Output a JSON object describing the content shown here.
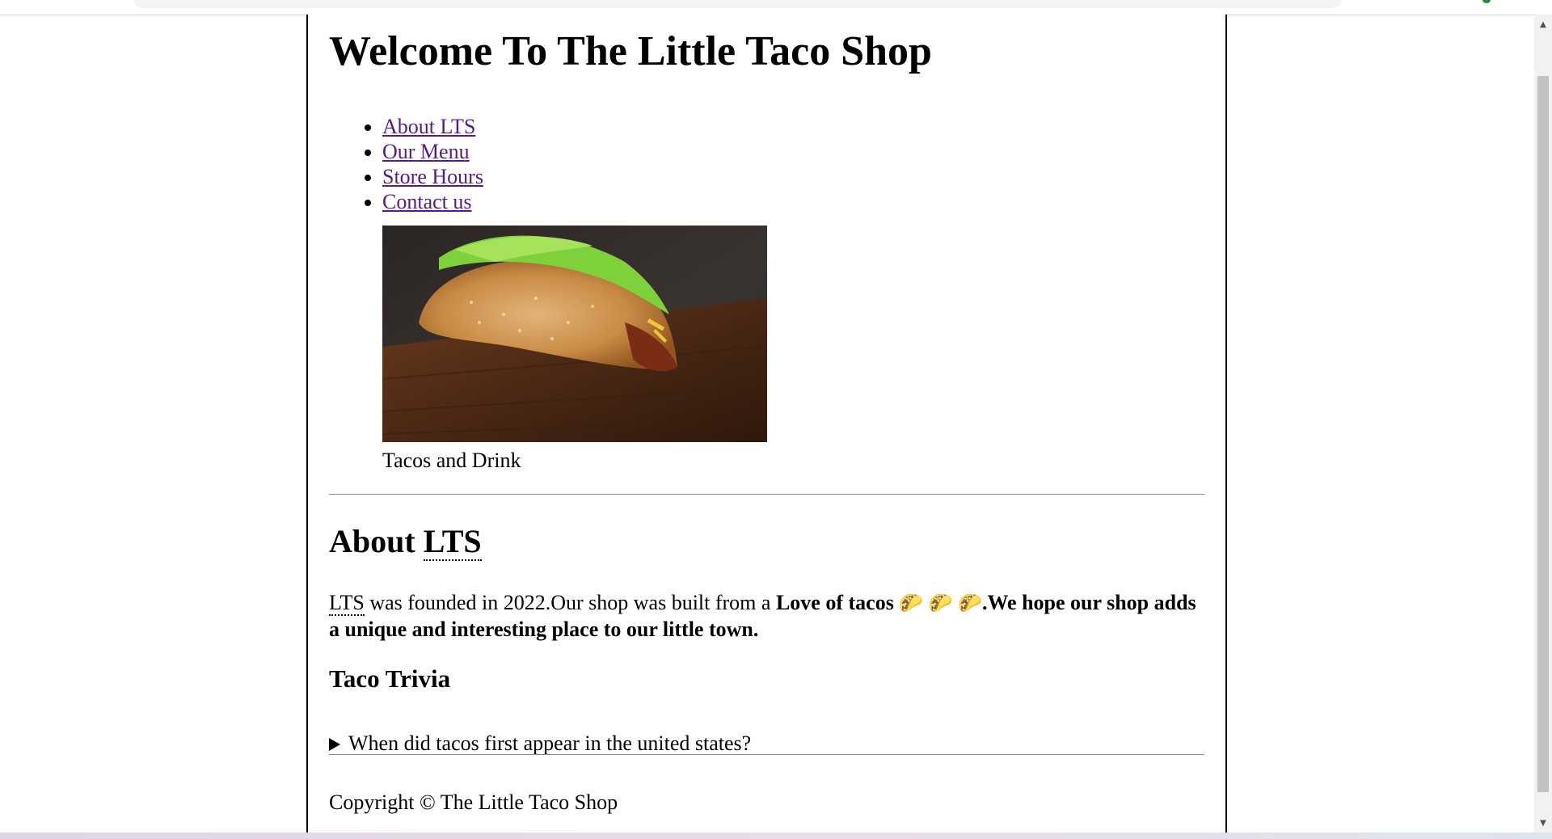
{
  "page": {
    "title": "Welcome To The Little Taco Shop",
    "nav": [
      {
        "label": "About LTS"
      },
      {
        "label": "Our Menu"
      },
      {
        "label": "Store Hours"
      },
      {
        "label": "Contact us"
      }
    ],
    "figure": {
      "caption": "Tacos and Drink",
      "image": "taco-photo"
    },
    "about": {
      "heading_prefix": "About ",
      "heading_abbr": "LTS",
      "text_abbr": "LTS",
      "text_plain": " was founded in 2022.Our shop was built from a ",
      "text_bold_1": "Love of tacos",
      "taco_emoji": "🌮",
      "text_bold_2": ".We hope our shop adds a unique and interesting place to our little town."
    },
    "trivia": {
      "heading": "Taco Trivia",
      "summary": "When did tacos first appear in the united states?"
    },
    "footer": {
      "copyright": "Copyright © The Little Taco Shop"
    }
  },
  "colors": {
    "link": "#551a8b",
    "rule": "#8c8c8c",
    "scroll_track": "#f1f1f1",
    "scroll_thumb": "#c1c1c1"
  },
  "icons": {
    "scroll_up": "▲",
    "scroll_down": "▼"
  }
}
